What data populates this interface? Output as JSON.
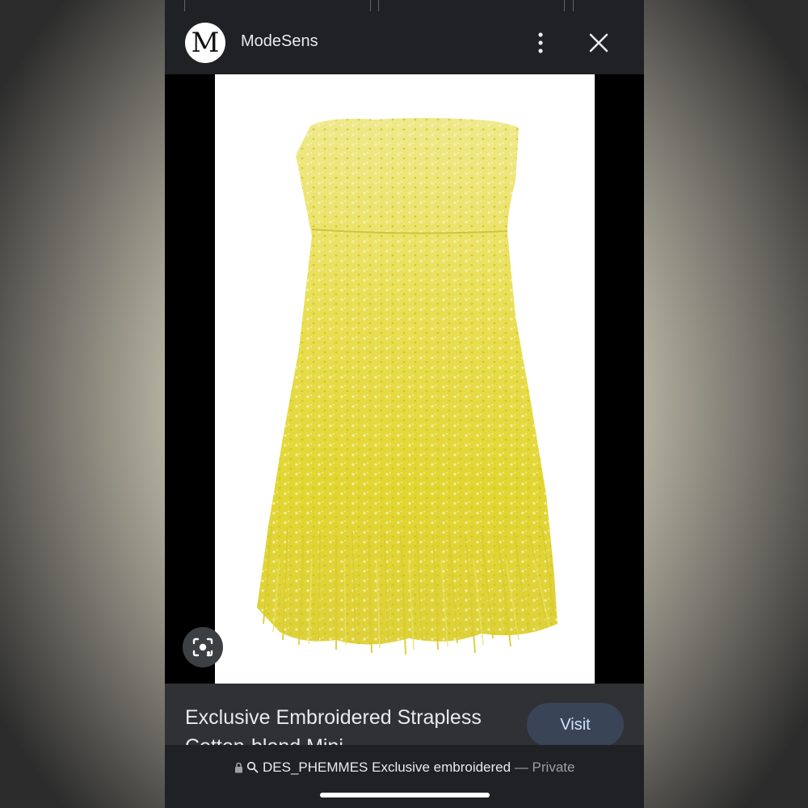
{
  "header": {
    "logo_letter": "M",
    "site_name": "ModeSens"
  },
  "product": {
    "title": "Exclusive Embroidered Strapless Cotton-blend Mini",
    "visit_label": "Visit"
  },
  "url_bar": {
    "domain_text": "DES_PHEMMES Exclusive embroidered",
    "privacy_text": "— Private"
  },
  "colors": {
    "dress_yellow": "#e4d83a",
    "panel_bg": "#303134",
    "visit_bg": "#394457"
  },
  "icons": [
    "more-vert-icon",
    "close-icon",
    "lens-icon",
    "lock-icon",
    "search-icon"
  ]
}
